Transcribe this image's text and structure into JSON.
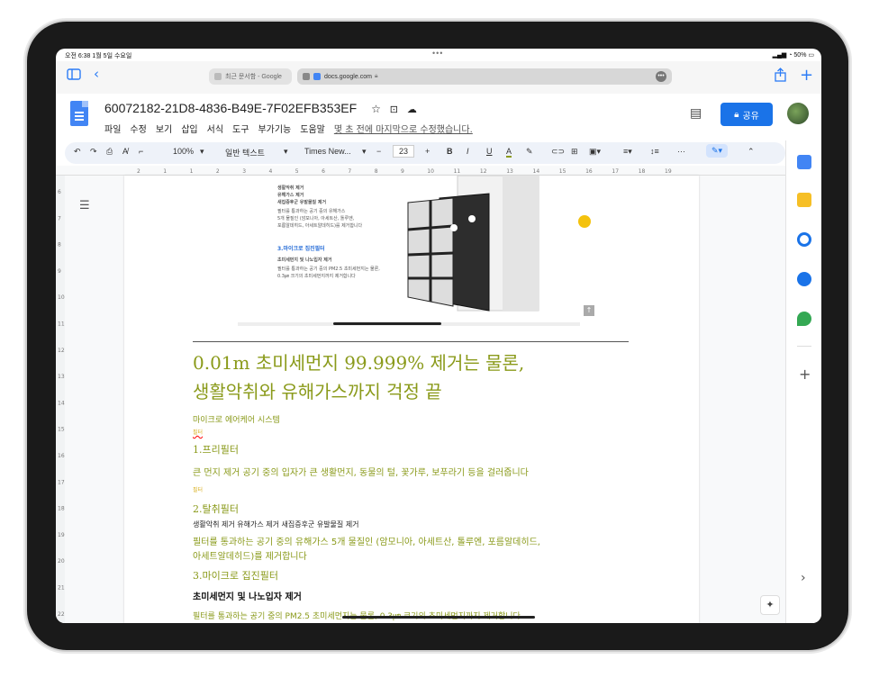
{
  "status": {
    "time_date": "오전 6:38  1월 5일 수요일",
    "dots": "•••",
    "right": "50%"
  },
  "browser": {
    "tab_inactive": "최근 문서함 - Google",
    "tab_active_url": "docs.google.com"
  },
  "doc": {
    "title": "60072182-21D8-4836-B49E-7F02EFB353EF",
    "menu": [
      "파일",
      "수정",
      "보기",
      "삽입",
      "서식",
      "도구",
      "부가기능",
      "도움말"
    ],
    "last_edit": "몇 초 전에 마지막으로 수정했습니다.",
    "share_label": "공유"
  },
  "toolbar": {
    "zoom": "100%",
    "style": "일반 텍스트",
    "font": "Times New...",
    "minus": "−",
    "font_size": "23",
    "plus": "+",
    "bold": "B",
    "italic": "I",
    "underline": "U",
    "color_a": "A",
    "more": "···"
  },
  "ruler": {
    "h_ticks": [
      "2",
      "1",
      "1",
      "2",
      "3",
      "4",
      "5",
      "6",
      "7",
      "8",
      "9",
      "10",
      "11",
      "12",
      "13",
      "14",
      "15",
      "16",
      "17",
      "18",
      "19"
    ],
    "v_ticks": [
      "6",
      "7",
      "8",
      "9",
      "10",
      "11",
      "12",
      "13",
      "14",
      "15",
      "16",
      "17",
      "18",
      "19",
      "20",
      "21",
      "22"
    ]
  },
  "embed": {
    "line1": "생활악취 제거",
    "line2": "유해가스 제거",
    "line3": "새집증후군 유발물질 제거",
    "line4": "필터를 통과하는 공기 중의 유해가스",
    "line5": "5개 물질인 (암모니아, 아세트산, 톨루엔,",
    "line6": "포름알데히드, 아세트알데히드)를 제거합니다",
    "sub_title": "3.마이크로 집진필터",
    "sub1": "초미세먼지 및 나노입자 제거",
    "sub2": "필터를 통과하는 공기 중의 PM2.5 초미세먼지는 물론,",
    "sub3": "0.3㎛ 크기의 초미세먼지까지 제거합니다"
  },
  "content": {
    "heading1": "0.01m 초미세먼지 99.999% 제거는 물론,",
    "heading2": "생활악취와 유해가스까지 걱정 끝",
    "system": "마이크로 에어케어 시스템",
    "small1": "필터",
    "pre_filter": "1.프리필터",
    "pre_desc": "큰 먼지 제거 공기 중의 입자가 큰 생활먼지, 동물의 털, 꽃가루, 보푸라기 등을 걸러줍니다",
    "small2": "필터",
    "deo_filter": "2.탈취필터",
    "deo_sub": "생활악취 제거 유해가스 제거 새집증후군 유발물질 제거",
    "deo_desc1": "필터를 통과하는 공기 중의 유해가스 5개 물질인 (암모니아, 아세트산, 톨루엔, 포름알데히드,",
    "deo_desc2": "아세트알데히드)를 제거합니다",
    "micro_filter": "3.마이크로 집진필터",
    "micro_sub": "초미세먼지 및 나노입자 제거",
    "micro_desc": "필터를 통과하는 공기 중의 PM2.5 초미세먼지는 물론, 0.3㎛ 크기의 초미세먼지까지 제거합니다"
  },
  "colors": {
    "olive": "#8a9a1a",
    "blue": "#1a73e8"
  }
}
